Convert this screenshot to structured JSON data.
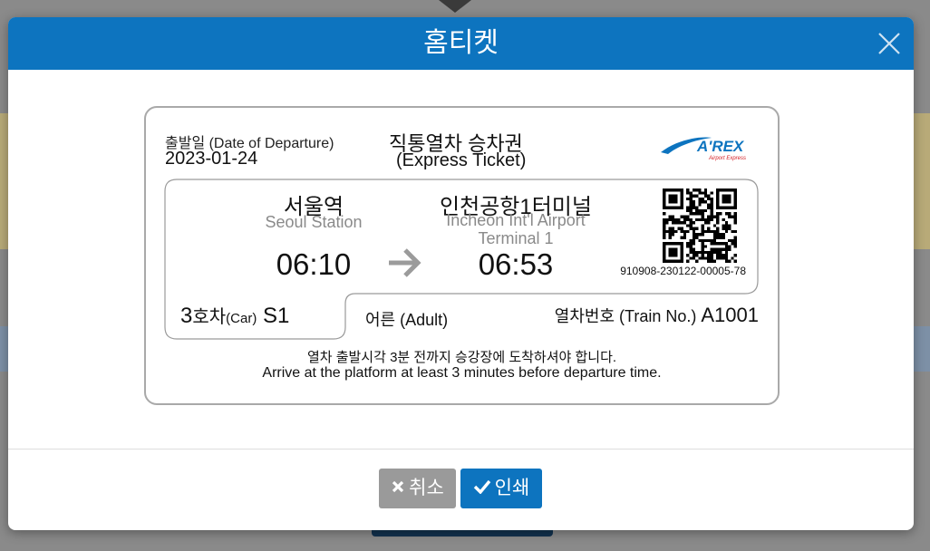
{
  "modal": {
    "title": "홈티켓"
  },
  "ticket": {
    "departure_date_label": "출발일 (Date of Departure)",
    "departure_date": "2023-01-24",
    "title": "직통열차 승차권",
    "subtitle": "(Express Ticket)",
    "logo": {
      "main": "A'REX",
      "tagline": "Airport Express",
      "color": "#0d74bf",
      "accent": "#d41f26"
    },
    "origin": {
      "name": "서울역",
      "name_en": "Seoul Station",
      "time": "06:10"
    },
    "destination": {
      "name": "인천공항1터미널",
      "name_en_line1": "Incheon Int'l Airport",
      "name_en_line2": "Terminal 1",
      "time": "06:53"
    },
    "ticket_number": "910908-230122-00005-78",
    "car": {
      "number": "3",
      "ko": "호차",
      "en": "(Car)",
      "seat": "S1"
    },
    "fare_type": "어른 (Adult)",
    "train": {
      "label": "열차번호 (Train No.)",
      "number": "A1001"
    },
    "notice_ko": "열차 출발시각 3분 전까지 승강장에 도착하셔야 합니다.",
    "notice_en": "Arrive at the platform at least 3 minutes before departure time."
  },
  "buttons": {
    "cancel_label": "취소",
    "print_label": "인쇄"
  },
  "colors": {
    "header": "#0d74bf",
    "cancel": "#9a9a9a",
    "print": "#0d74bf"
  }
}
